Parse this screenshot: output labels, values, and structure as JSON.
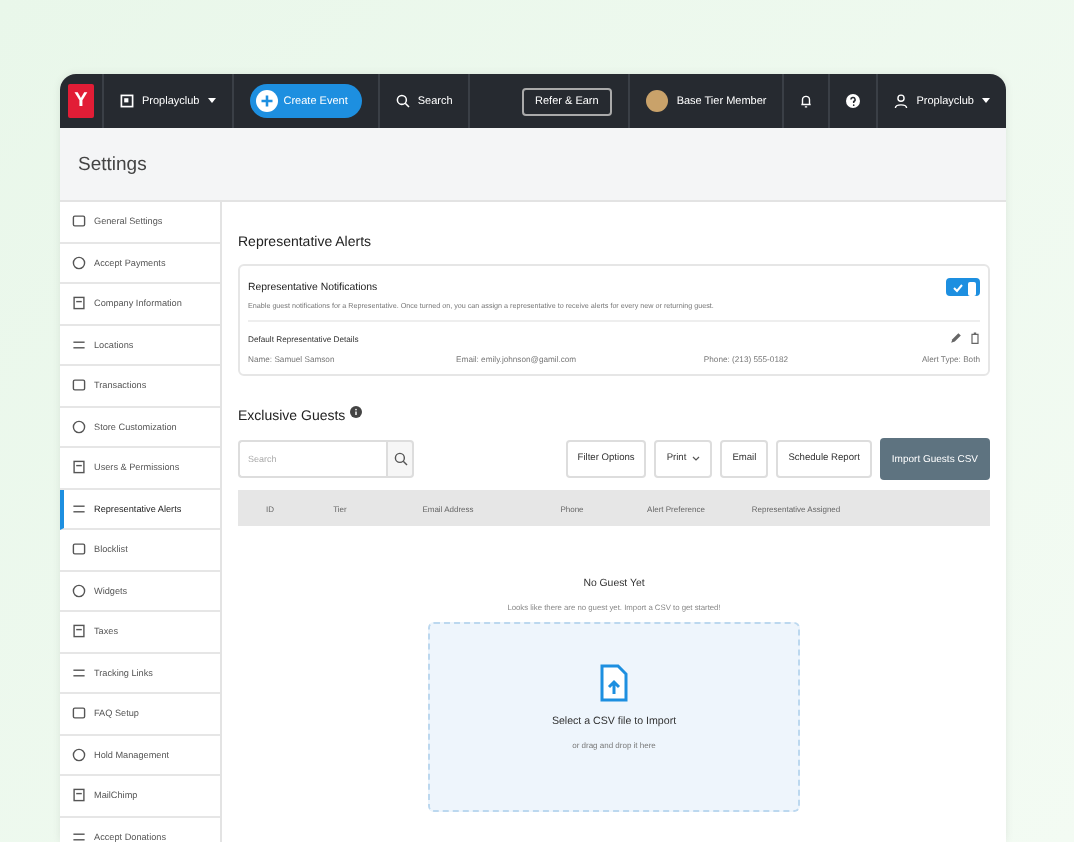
{
  "nav": {
    "logo": "Y",
    "account": "Proplayclub",
    "create_button": "Create Event",
    "search": "Search",
    "refer_button": "Refer & Earn",
    "tier": "Base Tier Member",
    "user": "Proplayclub"
  },
  "page_title": "Settings",
  "sidebar": {
    "items": [
      {
        "label": "General Settings",
        "selected": false
      },
      {
        "label": "Accept Payments",
        "selected": false
      },
      {
        "label": "Company Information",
        "selected": false
      },
      {
        "label": "Locations",
        "selected": false
      },
      {
        "label": "Transactions",
        "selected": false
      },
      {
        "label": "Store Customization",
        "selected": false
      },
      {
        "label": "Users & Permissions",
        "selected": false
      },
      {
        "label": "Representative Alerts",
        "selected": true
      },
      {
        "label": "Blocklist",
        "selected": false
      },
      {
        "label": "Widgets",
        "selected": false
      },
      {
        "label": "Taxes",
        "selected": false
      },
      {
        "label": "Tracking Links",
        "selected": false
      },
      {
        "label": "FAQ Setup",
        "selected": false
      },
      {
        "label": "Hold Management",
        "selected": false
      },
      {
        "label": "MailChimp",
        "selected": false
      },
      {
        "label": "Accept Donations",
        "selected": false
      }
    ]
  },
  "alerts": {
    "title": "Representative Alerts",
    "notifications": {
      "title": "Representative Notifications",
      "on": true,
      "description": "Enable guest notifications for a Representative. Once turned on, you can assign a representative to receive alerts for every new or returning guest."
    },
    "details": {
      "title": "Default Representative Details",
      "fields": [
        "Name: Samuel Samson",
        "Email: emily.johnson@gamil.com",
        "Phone: (213) 555-0182",
        "Alert Type: Both"
      ]
    }
  },
  "guests": {
    "title": "Exclusive Guests",
    "search": {
      "placeholder": "Search"
    },
    "buttons": [
      "Filter Options",
      "Print",
      "Email",
      "Schedule Report"
    ],
    "import_button": "Import Guests CSV",
    "table": {
      "columns": [
        "ID",
        "Tier",
        "Email Address",
        "Phone",
        "Alert Preference",
        "Representative Assigned"
      ]
    },
    "empty": {
      "title": "No Guest Yet",
      "message": "Looks like there are no guest yet. Import a CSV to get started!"
    },
    "upload": {
      "title": "Select a CSV file to Import",
      "hint": "or drag and drop it here"
    }
  }
}
